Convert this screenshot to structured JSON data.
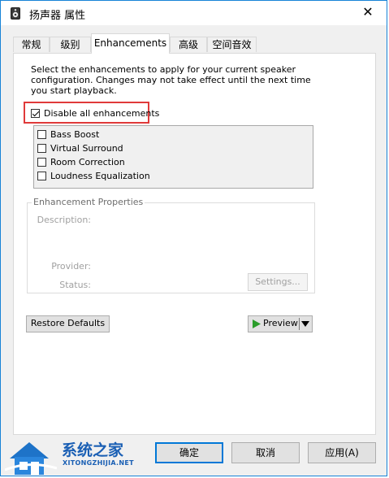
{
  "window": {
    "title": "扬声器 属性",
    "close_glyph": "✕"
  },
  "tabs": [
    {
      "label": "常规"
    },
    {
      "label": "级别"
    },
    {
      "label": "Enhancements"
    },
    {
      "label": "高级"
    },
    {
      "label": "空间音效"
    }
  ],
  "enhancements": {
    "description": "Select the enhancements to apply for your current speaker configuration. Changes may not take effect until the next time you start playback.",
    "disable_all": {
      "label": "Disable all enhancements",
      "checked": true
    },
    "items": [
      {
        "label": "Bass Boost",
        "checked": false
      },
      {
        "label": "Virtual Surround",
        "checked": false
      },
      {
        "label": "Room Correction",
        "checked": false
      },
      {
        "label": "Loudness Equalization",
        "checked": false
      }
    ],
    "properties": {
      "group_label": "Enhancement Properties",
      "description_label": "Description:",
      "provider_label": "Provider:",
      "status_label": "Status:",
      "settings_button": "Settings..."
    },
    "restore_defaults": "Restore Defaults",
    "preview": "Preview"
  },
  "footer": {
    "ok": "确定",
    "cancel": "取消",
    "apply": "应用(A)"
  },
  "watermark": {
    "name": "系统之家",
    "url": "XITONGZHIJIA.NET"
  },
  "colors": {
    "accent": "#0078d7",
    "highlight": "#e03a3a",
    "preview_play": "#2a9d2a"
  }
}
